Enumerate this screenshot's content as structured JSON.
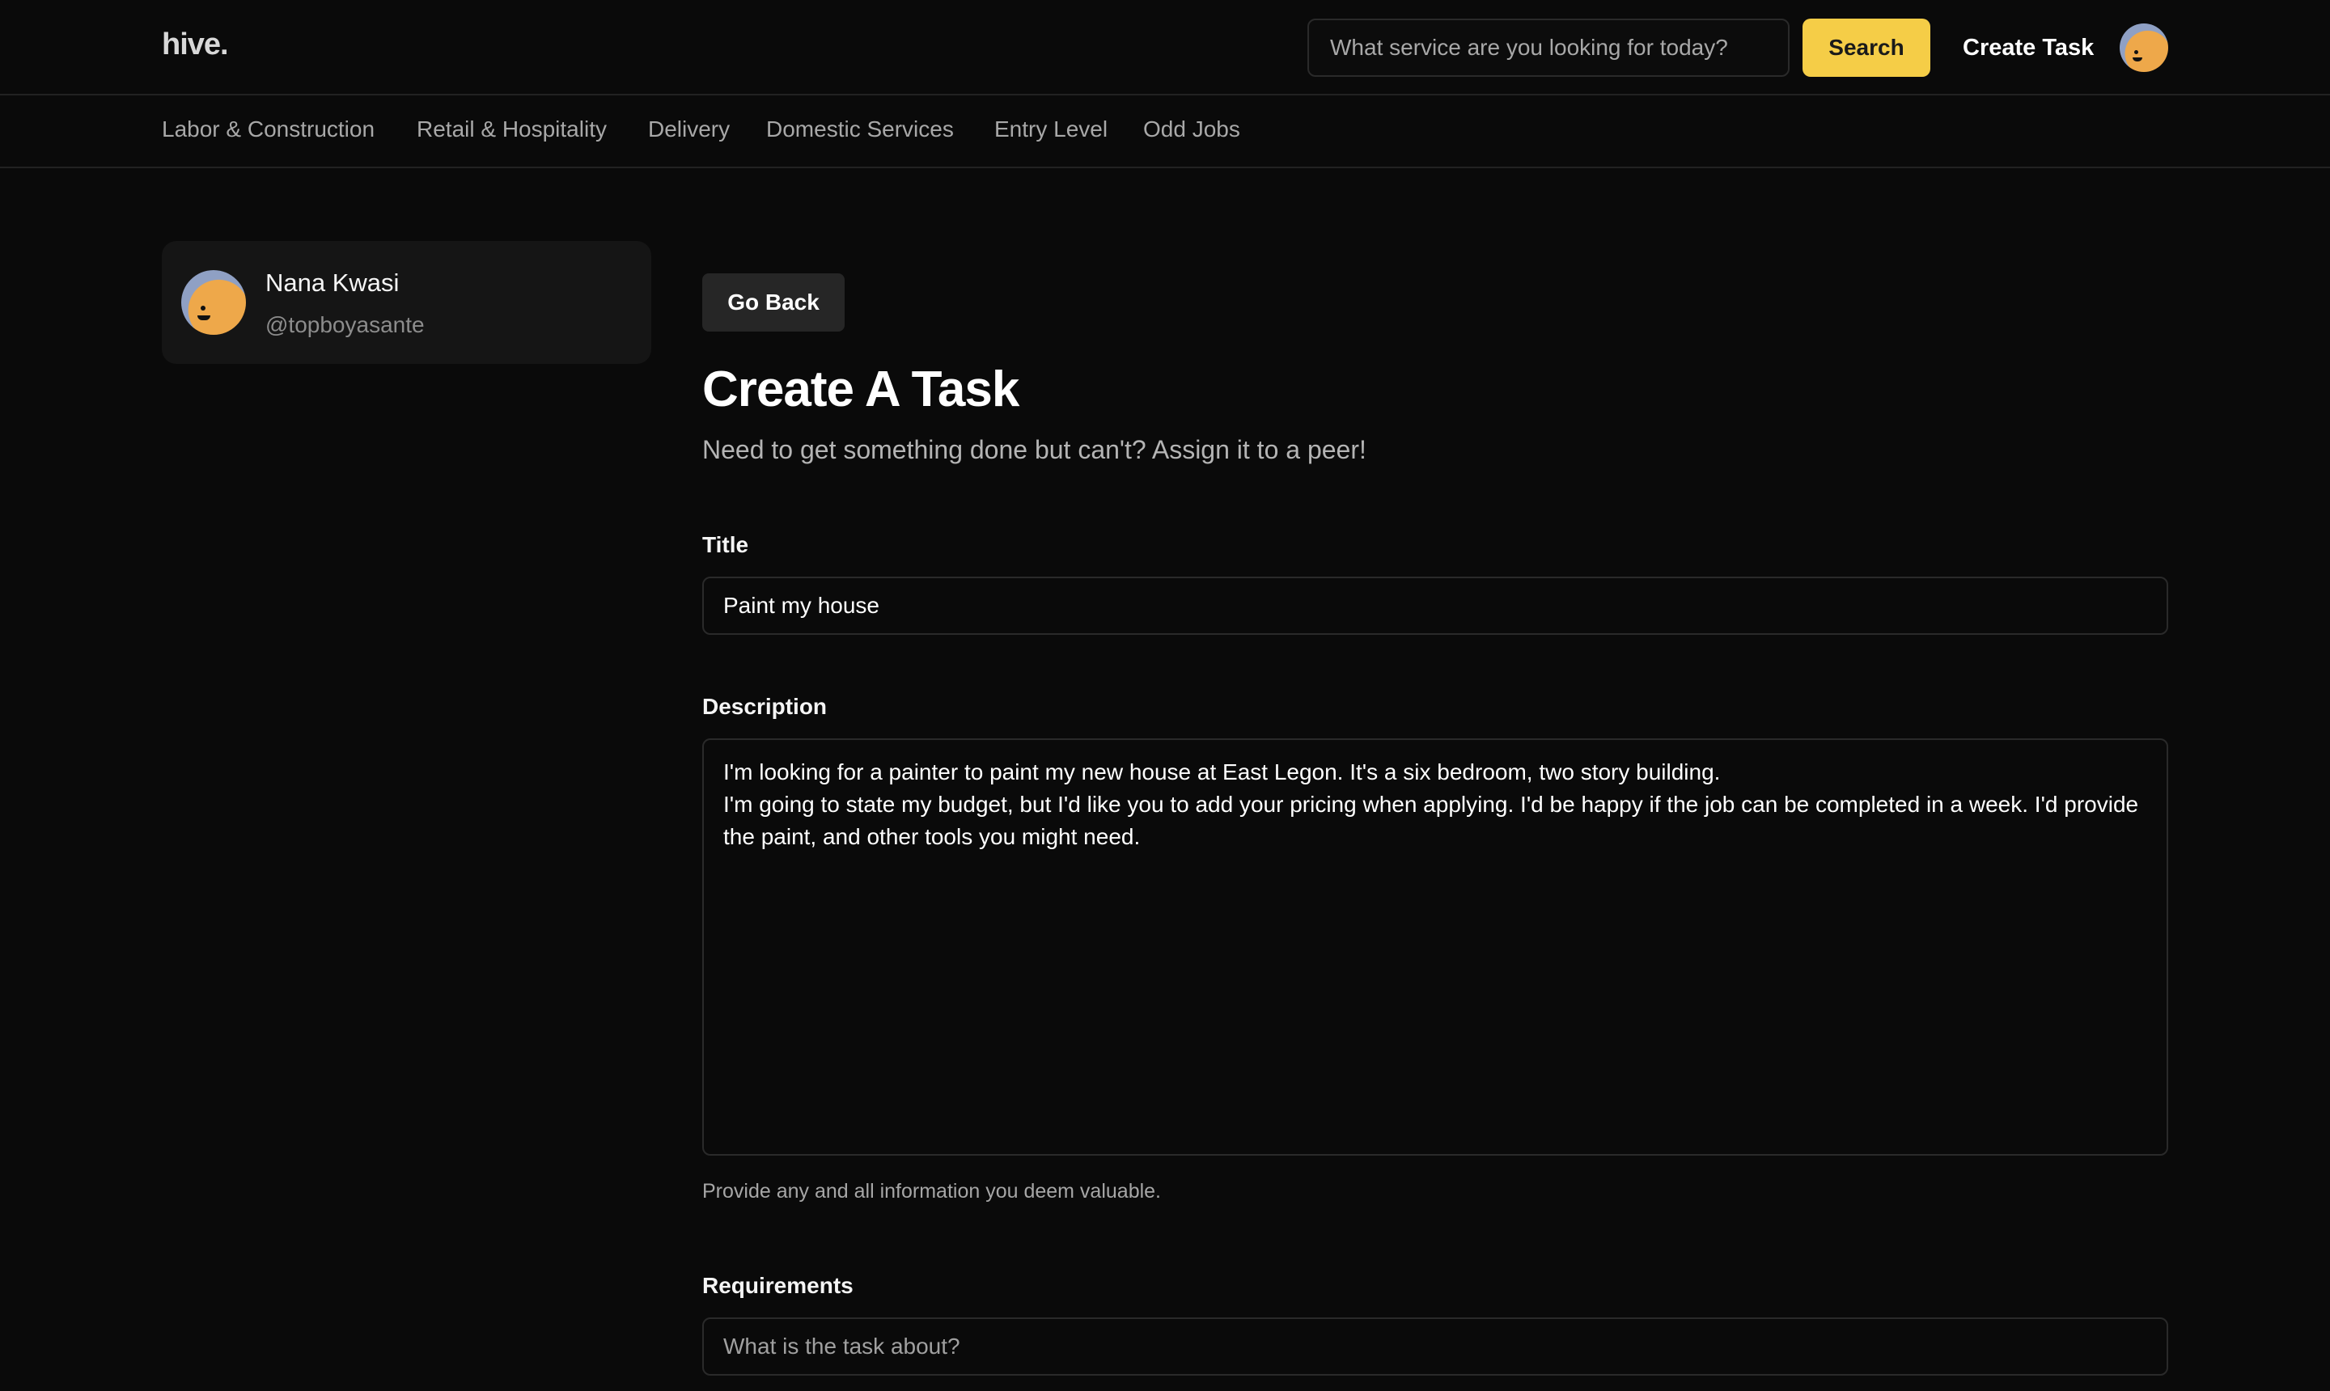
{
  "header": {
    "logo": "hive.",
    "search_placeholder": "What service are you looking for today?",
    "search_button": "Search",
    "create_task": "Create Task"
  },
  "categories": [
    "Labor & Construction",
    "Retail & Hospitality",
    "Delivery",
    "Domestic Services",
    "Entry Level",
    "Odd Jobs"
  ],
  "profile": {
    "name": "Nana Kwasi",
    "handle": "@topboyasante"
  },
  "form": {
    "go_back": "Go Back",
    "title": "Create A Task",
    "subtitle": "Need to get something done but can't? Assign it to a peer!",
    "title_label": "Title",
    "title_value": "Paint my house",
    "description_label": "Description",
    "description_value": "I'm looking for a painter to paint my new house at East Legon. It's a six bedroom, two story building.\nI'm going to state my budget, but I'd like you to add your pricing when applying. I'd be happy if the job can be completed in a week. I'd provide the paint, and other tools you might need.",
    "description_help": "Provide any and all information you deem valuable.",
    "requirements_label": "Requirements",
    "requirements_placeholder": "What is the task about?"
  },
  "colors": {
    "background": "#0a0a0a",
    "accent": "#f5cd47",
    "card": "#151515",
    "border": "#2a2a2a"
  }
}
